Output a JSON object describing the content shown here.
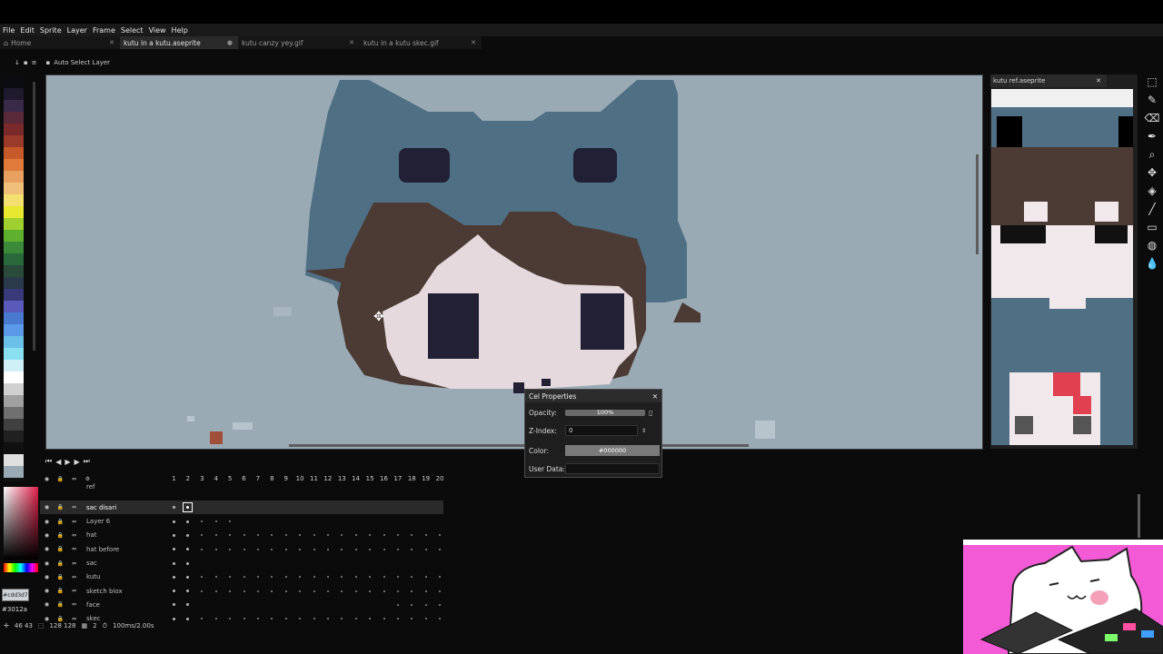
{
  "menu": [
    "File",
    "Edit",
    "Sprite",
    "Layer",
    "Frame",
    "Select",
    "View",
    "Help"
  ],
  "tabs": [
    {
      "label": "Home",
      "active": false,
      "home": true
    },
    {
      "label": "kutu in a kutu.aseprite",
      "active": true
    },
    {
      "label": "kutu canzy yey.gif",
      "active": false
    },
    {
      "label": "kutu in a kutu skec.gif",
      "active": false
    }
  ],
  "context_bar": {
    "auto_select_label": "Auto Select Layer"
  },
  "palette": [
    "#0b0b12",
    "#1f1a2e",
    "#3a2a4a",
    "#5a2a3a",
    "#7a2a2a",
    "#9a3a2a",
    "#c65a2a",
    "#e07a3a",
    "#e8a060",
    "#f0c07a",
    "#f4e070",
    "#e8e830",
    "#a0d030",
    "#60b030",
    "#3a8a3a",
    "#2a6a3a",
    "#2a4a3a",
    "#2a3a4a",
    "#3a3a7a",
    "#5a5aba",
    "#4a7ad0",
    "#5a9ae8",
    "#6ac0e8",
    "#8ae0f0",
    "#d0f0f8",
    "#ffffff",
    "#d0d0d0",
    "#a0a0a0",
    "#707070",
    "#404040",
    "#202020",
    "#101010",
    "#e0e0e0",
    "#9aaab5"
  ],
  "reference": {
    "title": "kutu ref.aseprite"
  },
  "timeline": {
    "frame_numbers": [
      "1",
      "2",
      "3",
      "4",
      "5",
      "6",
      "7",
      "8",
      "9",
      "10",
      "11",
      "12",
      "13",
      "14",
      "15",
      "16",
      "17",
      "18",
      "19",
      "20"
    ],
    "layers": [
      {
        "name": "ref",
        "selected": false
      },
      {
        "name": "sac disari",
        "selected": true
      },
      {
        "name": "Layer 6",
        "selected": false
      },
      {
        "name": "hat",
        "selected": false
      },
      {
        "name": "hat before",
        "selected": false
      },
      {
        "name": "sac",
        "selected": false
      },
      {
        "name": "kutu",
        "selected": false
      },
      {
        "name": "sketch biox",
        "selected": false
      },
      {
        "name": "face",
        "selected": false
      },
      {
        "name": "skec",
        "selected": false
      }
    ]
  },
  "color": {
    "fg_hex": "#cdd3d7",
    "fg_label": "#cdd3d7",
    "bg_label": "#3012a"
  },
  "status": {
    "coords": "46 43",
    "size": "128 128",
    "frame": "2",
    "duration": "100ms/2.00s"
  },
  "cel_properties": {
    "title": "Cel Properties",
    "opacity_label": "Opacity:",
    "opacity_value": "100%",
    "opacity_fraction": 1.0,
    "zindex_label": "Z-Index:",
    "zindex_value": "0",
    "color_label": "Color:",
    "color_value": "#000000",
    "userdata_label": "User Data:",
    "userdata_value": ""
  }
}
